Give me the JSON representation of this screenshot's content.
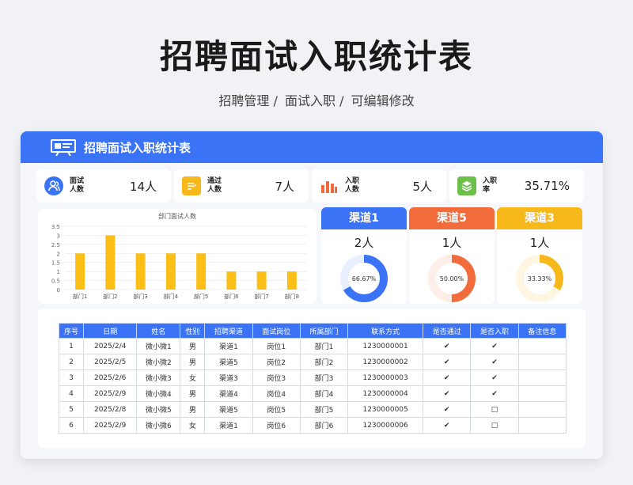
{
  "page": {
    "title": "招聘面试入职统计表",
    "breadcrumb": [
      "招聘管理 /",
      "面试入职 /",
      "可编辑修改"
    ]
  },
  "card": {
    "header_title": "招聘面试入职统计表"
  },
  "stats": [
    {
      "label": "面试人数",
      "label_l1": "面试",
      "label_l2": "人数",
      "value": "14人",
      "color": "#3a73f5",
      "icon": "users-icon"
    },
    {
      "label": "通过人数",
      "label_l1": "通过",
      "label_l2": "人数",
      "value": "7人",
      "color": "#f7b81b",
      "icon": "document-icon"
    },
    {
      "label": "入职人数",
      "label_l1": "入职",
      "label_l2": "人数",
      "value": "5人",
      "color": "#f26b3a",
      "icon": "bar-chart-icon"
    },
    {
      "label": "入职率",
      "label_l1": "入职",
      "label_l2": "率",
      "value": "35.71%",
      "color": "#6cc04a",
      "icon": "layers-icon"
    }
  ],
  "chart_data": {
    "type": "bar",
    "title": "部门面试人数",
    "categories": [
      "部门1",
      "部门2",
      "部门3",
      "部门4",
      "部门5",
      "部门6",
      "部门7",
      "部门8"
    ],
    "values": [
      2,
      3,
      2,
      2,
      2,
      1,
      1,
      1
    ],
    "ylim": [
      0,
      3.5
    ],
    "yticks": [
      "0",
      "0.5",
      "1",
      "1.5",
      "2",
      "2.5",
      "3",
      "3.5"
    ],
    "color": "#fbbf18",
    "grid": true
  },
  "channels": [
    {
      "name": "渠道1",
      "value": "2人",
      "percent": 66.67,
      "percent_label": "66.67%",
      "color": "#3a73f5",
      "track": "#e8effe"
    },
    {
      "name": "渠道5",
      "value": "1人",
      "percent": 50.0,
      "percent_label": "50.00%",
      "color": "#f26b3a",
      "track": "#fdeee8"
    },
    {
      "name": "渠道3",
      "value": "1人",
      "percent": 33.33,
      "percent_label": "33.33%",
      "color": "#f7b81b",
      "track": "#fef6e0"
    }
  ],
  "table": {
    "headers": [
      "序号",
      "日期",
      "姓名",
      "性别",
      "招聘渠道",
      "面试岗位",
      "所属部门",
      "联系方式",
      "是否通过",
      "是否入职",
      "备注信息"
    ],
    "rows": [
      [
        "1",
        "2025/2/4",
        "微小微1",
        "男",
        "渠道1",
        "岗位1",
        "部门1",
        "1230000001",
        "✔",
        "✔",
        ""
      ],
      [
        "2",
        "2025/2/5",
        "微小微2",
        "男",
        "渠道5",
        "岗位2",
        "部门2",
        "1230000002",
        "✔",
        "✔",
        ""
      ],
      [
        "3",
        "2025/2/6",
        "微小微3",
        "女",
        "渠道3",
        "岗位3",
        "部门3",
        "1230000003",
        "✔",
        "✔",
        ""
      ],
      [
        "4",
        "2025/2/9",
        "微小微4",
        "男",
        "渠道4",
        "岗位4",
        "部门4",
        "1230000004",
        "✔",
        "✔",
        ""
      ],
      [
        "5",
        "2025/2/8",
        "微小微5",
        "男",
        "渠道5",
        "岗位5",
        "部门5",
        "1230000005",
        "✔",
        "□",
        ""
      ],
      [
        "6",
        "2025/2/9",
        "微小微6",
        "女",
        "渠道1",
        "岗位6",
        "部门6",
        "1230000006",
        "✔",
        "□",
        ""
      ]
    ]
  }
}
